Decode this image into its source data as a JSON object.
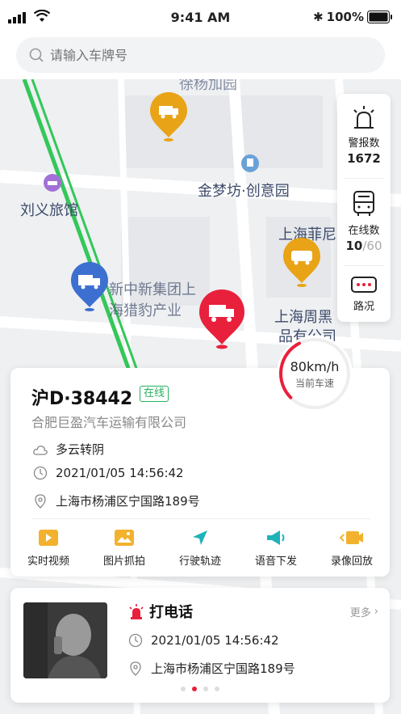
{
  "status": {
    "time": "9:41 AM",
    "battery": "100%"
  },
  "search": {
    "placeholder": "请输入车牌号"
  },
  "map_labels": [
    "金梦坊·创意园",
    "刘义旅馆",
    "新中新集团上",
    "海猎豹产业",
    "上海菲尼",
    "上海周黑",
    "徐杨加园",
    "品有公司"
  ],
  "side_panel": {
    "alarm_label": "警报数",
    "alarm_count": "1672",
    "online_label": "在线数",
    "online_now": "10",
    "online_total": "60",
    "road_label": "路况"
  },
  "speed": {
    "value": "80km/h",
    "label": "当前车速",
    "level": 0.4
  },
  "vehicle": {
    "plate": "沪D·38442",
    "status": "在线",
    "company": "合肥巨盈汽车运输有限公司",
    "weather": "多云转阴",
    "datetime": "2021/01/05 14:56:42",
    "address": "上海市杨浦区宁国路189号"
  },
  "actions": [
    {
      "label": "实时视频",
      "icon": "video-icon"
    },
    {
      "label": "图片抓拍",
      "icon": "image-icon"
    },
    {
      "label": "行驶轨迹",
      "icon": "navigation-icon"
    },
    {
      "label": "语音下发",
      "icon": "megaphone-icon"
    },
    {
      "label": "录像回放",
      "icon": "playback-icon"
    }
  ],
  "alert": {
    "title": "打电话",
    "more": "更多",
    "datetime": "2021/01/05 14:56:42",
    "address": "上海市杨浦区宁国路189号"
  },
  "colors": {
    "accent": "#e8203c",
    "online": "#25b05e",
    "map_blue": "#3d6fd0",
    "map_orange": "#e8a317",
    "road_green": "#34c759"
  }
}
